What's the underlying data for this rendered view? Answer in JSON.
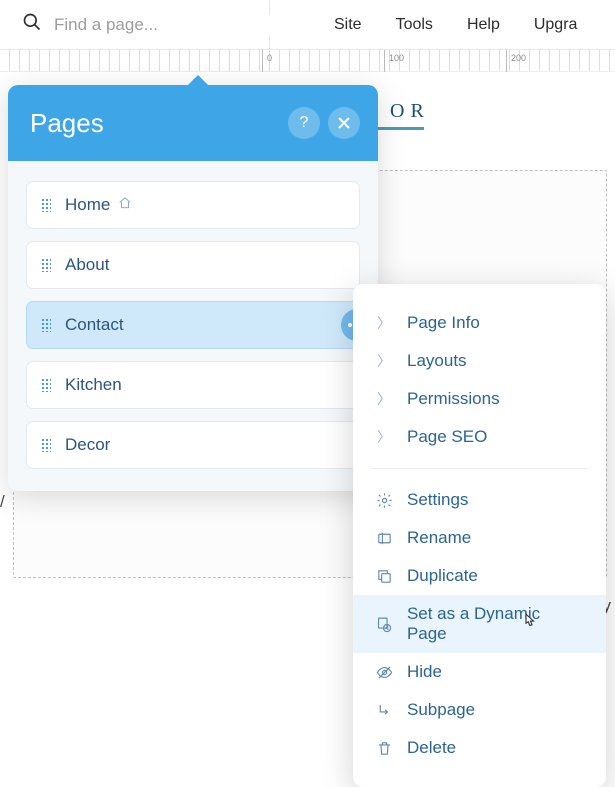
{
  "top": {
    "search_placeholder": "Find a page...",
    "menu": [
      "Site",
      "Tools",
      "Help",
      "Upgra"
    ]
  },
  "ruler": {
    "ticks": [
      0,
      100,
      200
    ]
  },
  "canvas": {
    "title_fragment": "OR"
  },
  "panel": {
    "title": "Pages",
    "help": "?",
    "pages": [
      {
        "label": "Home",
        "home": true
      },
      {
        "label": "About"
      },
      {
        "label": "Contact",
        "selected": true,
        "more": true
      },
      {
        "label": "Kitchen"
      },
      {
        "label": "Decor"
      }
    ]
  },
  "context": {
    "nav": [
      {
        "label": "Page Info"
      },
      {
        "label": "Layouts"
      },
      {
        "label": "Permissions"
      },
      {
        "label": "Page SEO"
      }
    ],
    "actions": [
      {
        "label": "Settings",
        "icon": "gear"
      },
      {
        "label": "Rename",
        "icon": "rename"
      },
      {
        "label": "Duplicate",
        "icon": "duplicate"
      },
      {
        "label": "Set as a Dynamic Page",
        "icon": "dynamic",
        "hover": true
      },
      {
        "label": "Hide",
        "icon": "hide"
      },
      {
        "label": "Subpage",
        "icon": "subpage"
      },
      {
        "label": "Delete",
        "icon": "delete"
      }
    ]
  },
  "colors": {
    "accent": "#3ea6e6",
    "text_link": "#2b6492"
  }
}
